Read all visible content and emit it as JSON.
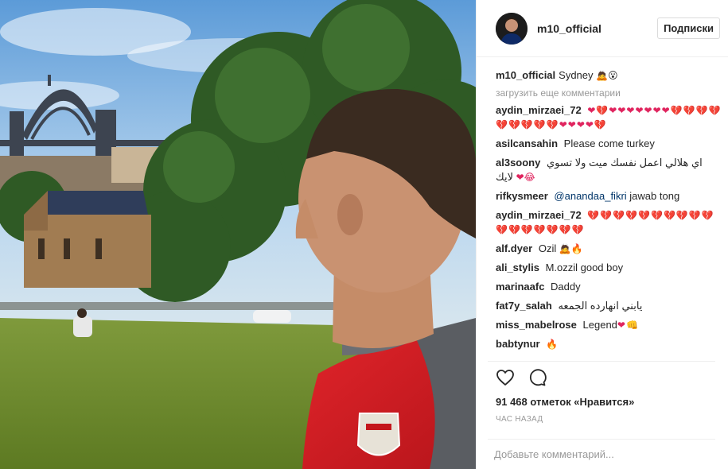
{
  "header": {
    "username": "m10_official",
    "follow_label": "Подписки"
  },
  "caption": {
    "username": "m10_official",
    "text": "Sydney",
    "emoji": "🙇😮"
  },
  "load_more_label": "загрузить еще комментарии",
  "comments": [
    {
      "user": "aydin_mirzaei_72",
      "text": "❤💔❤❤❤❤❤❤❤💔💔💔💔💔💔💔💔💔❤❤❤❤💔"
    },
    {
      "user": "asilcansahin",
      "text": "Please come turkey"
    },
    {
      "user": "al3soony",
      "text": "اي هلالي اعمل نفسك ميت ولا تسوي لايك",
      "trail": "❤😂"
    },
    {
      "user": "rifkysmeer",
      "mention": "@anandaa_fikri",
      "text": "jawab tong"
    },
    {
      "user": "aydin_mirzaei_72",
      "text": "💔💔💔💔💔💔💔💔💔💔💔💔💔💔💔💔💔"
    },
    {
      "user": "alf.dyer",
      "text": "Ozil",
      "trail": "🙇🔥"
    },
    {
      "user": "ali_stylis",
      "text": "M.ozzil good boy"
    },
    {
      "user": "marinaafc",
      "text": "Daddy"
    },
    {
      "user": "fat7y_salah",
      "text": "يابني انهارده الجمعه"
    },
    {
      "user": "miss_mabelrose",
      "text": "Legend",
      "trail": "❤👊"
    },
    {
      "user": "babtynur",
      "text": "🔥"
    }
  ],
  "likes_label": "91 468 отметок «Нравится»",
  "time_label": "ЧАС НАЗАД",
  "add_comment_placeholder": "Добавьте комментарий...",
  "icons": [
    "heart-icon",
    "comment-icon"
  ],
  "colors": {
    "accent": "#e0245e",
    "link": "#003569",
    "muted": "#999999",
    "border": "#efefef"
  }
}
